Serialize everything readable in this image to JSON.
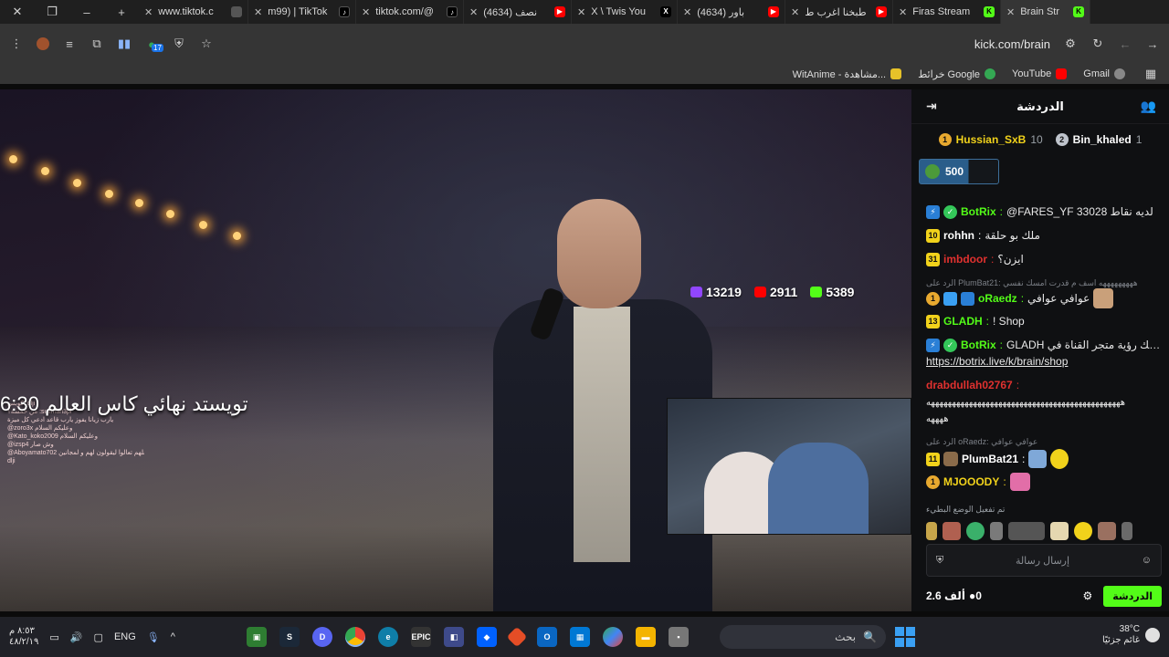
{
  "tabs": [
    {
      "title": "www.tiktok.c",
      "favicon_color": "#555555"
    },
    {
      "title": "m99) | TikTok",
      "favicon_color": "#000000"
    },
    {
      "title": "tiktok.com/@",
      "favicon_color": "#000000"
    },
    {
      "title": "(4634) نصف",
      "favicon_color": "#ff0000"
    },
    {
      "title": "X \\ Twis You",
      "favicon_color": "#000000"
    },
    {
      "title": "(4634) باور",
      "favicon_color": "#ff0000"
    },
    {
      "title": "طبخنا اغرب ط",
      "favicon_color": "#ff0000"
    },
    {
      "title": "Firas Stream",
      "favicon_color": "#53fc18"
    },
    {
      "title": "Brain Str",
      "favicon_color": "#53fc18"
    }
  ],
  "address": {
    "url": "kick.com/brain",
    "extension_badge": "17"
  },
  "bookmarks": [
    {
      "label": "Gmail",
      "color": "#ea4335"
    },
    {
      "label": "YouTube",
      "color": "#ff0000"
    },
    {
      "label": "خرائط Google",
      "color": "#34a853"
    },
    {
      "label": "WitAnime - مشاهدة...",
      "color": "#e6c229"
    }
  ],
  "video": {
    "headline": "تويستد نهائي كاس العالم 6:30",
    "stats": {
      "twitch": "13219",
      "youtube": "2911",
      "kick": "5389"
    },
    "overlay_chat": [
      "كوبس :dlji",
      "من خمسة؟ :suliman3pi",
      "يارب زيانا يفوز يارب قاعد ادعي كل ميزة",
      "@zoro3x وعليكم السلام",
      "@Kato_koko2009 وعليكم السلام",
      "@izsp4 وش صار",
      "@Aboyamato702 يطلعلهم تعالوا ليقولون لهم و لمجانين",
      "dlji"
    ]
  },
  "chat": {
    "title": "الدردشة",
    "leaders": [
      {
        "name": "Hussian_SxB",
        "score": "10",
        "rank": "1"
      },
      {
        "name": "Bin_khaled",
        "score": "1",
        "rank": "2"
      }
    ],
    "gift_amount": "500",
    "messages": [
      {
        "badges": [
          "bot",
          "verified"
        ],
        "name": "BotRix",
        "name_color": "#53fc18",
        "text": "@FARES_YF 33028 لديه نقاط"
      },
      {
        "badges": [
          "10"
        ],
        "name": "rohhn",
        "name_color": "#ffffff",
        "text": "ملك بو حلقة"
      },
      {
        "badges": [
          "31"
        ],
        "name": "imbdoor",
        "name_color": "#e0312f",
        "text": "ايزن؟"
      },
      {
        "reply": "الرد على PlumBat21: هههههههههه اسف م قدرت امسك نفسي"
      },
      {
        "badges": [
          "gold",
          "sub"
        ],
        "name": "oRaedz",
        "name_color": "#53fc18",
        "text": "عوافي عوافي"
      },
      {
        "badges": [
          "13"
        ],
        "name": "GLADH",
        "name_color": "#53fc18",
        "text": "! Shop"
      },
      {
        "badges": [
          "bot",
          "verified"
        ],
        "name": "BotRix",
        "name_color": "#53fc18",
        "text": "GLADH يمكنك رؤية متجر القناة في"
      },
      {
        "link": "https://botrix.live/k/brain/shop"
      },
      {
        "badges": [],
        "name": "drabdullah02767",
        "name_color": "#e0312f",
        "text": ""
      },
      {
        "spam": "ههههههههههههههههههههههههههههههههههههههههههههههه"
      },
      {
        "spam2": "ههههه"
      },
      {
        "reply": "الرد على oRaedz: عوافي عوافي"
      },
      {
        "badges": [
          "11"
        ],
        "name": "PlumBat21",
        "name_color": "#ffffff",
        "text": ""
      },
      {
        "badges": [
          "gold"
        ],
        "name": "MJOOODY",
        "name_color": "#f1d21b",
        "text": ""
      }
    ],
    "notice": "تم تفعيل الوضع البطيء",
    "input_placeholder": "إرسال رسالة",
    "viewers": "2.6 ألف",
    "count": "0",
    "send_label": "الدردشة"
  },
  "taskbar": {
    "clock_time": "٨:٥٣ م",
    "clock_date": "٤٨/٢/١٩",
    "language": "ENG",
    "search_placeholder": "بحث",
    "weather_temp": "38°C",
    "weather_desc": "غائم جزئيًا"
  },
  "colors": {
    "kick_green": "#53fc18",
    "chat_bg": "#0f1012",
    "taskbar_bg": "#202127"
  }
}
